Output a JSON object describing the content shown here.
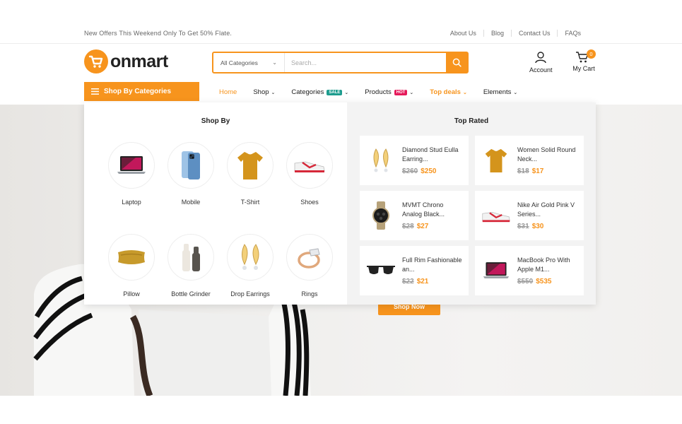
{
  "topbar": {
    "offer": "New Offers This Weekend Only To Get 50% Flate.",
    "links": [
      "About Us",
      "Blog",
      "Contact Us",
      "FAQs"
    ]
  },
  "header": {
    "logo_text": "onmart",
    "search": {
      "category": "All Categories",
      "placeholder": "Search..."
    },
    "account_label": "Account",
    "cart_label": "My Cart",
    "cart_count": "0"
  },
  "nav": {
    "shop_by": "Shop By Categories",
    "items": [
      {
        "label": "Home"
      },
      {
        "label": "Shop"
      },
      {
        "label": "Categories",
        "tag": "SALE"
      },
      {
        "label": "Products",
        "tag": "HOT"
      },
      {
        "label": "Top deals"
      },
      {
        "label": "Elements"
      }
    ],
    "tag_colors": {
      "sale": "#1d9c8e",
      "hot": "#e5195a"
    }
  },
  "mega": {
    "shop_by_title": "Shop By",
    "categories": [
      {
        "label": "Laptop",
        "icon": "laptop-icon"
      },
      {
        "label": "Mobile",
        "icon": "mobile-icon"
      },
      {
        "label": "T-Shirt",
        "icon": "tshirt-icon"
      },
      {
        "label": "Shoes",
        "icon": "shoe-icon"
      },
      {
        "label": "Pillow",
        "icon": "pillow-icon"
      },
      {
        "label": "Bottle Grinder",
        "icon": "grinder-icon"
      },
      {
        "label": "Drop Earrings",
        "icon": "earring-icon"
      },
      {
        "label": "Rings",
        "icon": "ring-icon"
      }
    ],
    "top_rated_title": "Top Rated",
    "products": [
      {
        "name": "Diamond Stud Eulla Earring...",
        "old": "$260",
        "new": "$250"
      },
      {
        "name": "Women Solid Round Neck...",
        "old": "$18",
        "new": "$17"
      },
      {
        "name": "MVMT Chrono Analog Black...",
        "old": "$28",
        "new": "$27"
      },
      {
        "name": "Nike Air Gold Pink V Series...",
        "old": "$31",
        "new": "$30"
      },
      {
        "name": "Full Rim Fashionable an...",
        "old": "$22",
        "new": "$21"
      },
      {
        "name": "MacBook Pro With Apple M1...",
        "old": "$550",
        "new": "$535"
      }
    ]
  },
  "hero": {
    "cta": "Shop Now"
  },
  "colors": {
    "accent": "#f7941d"
  }
}
